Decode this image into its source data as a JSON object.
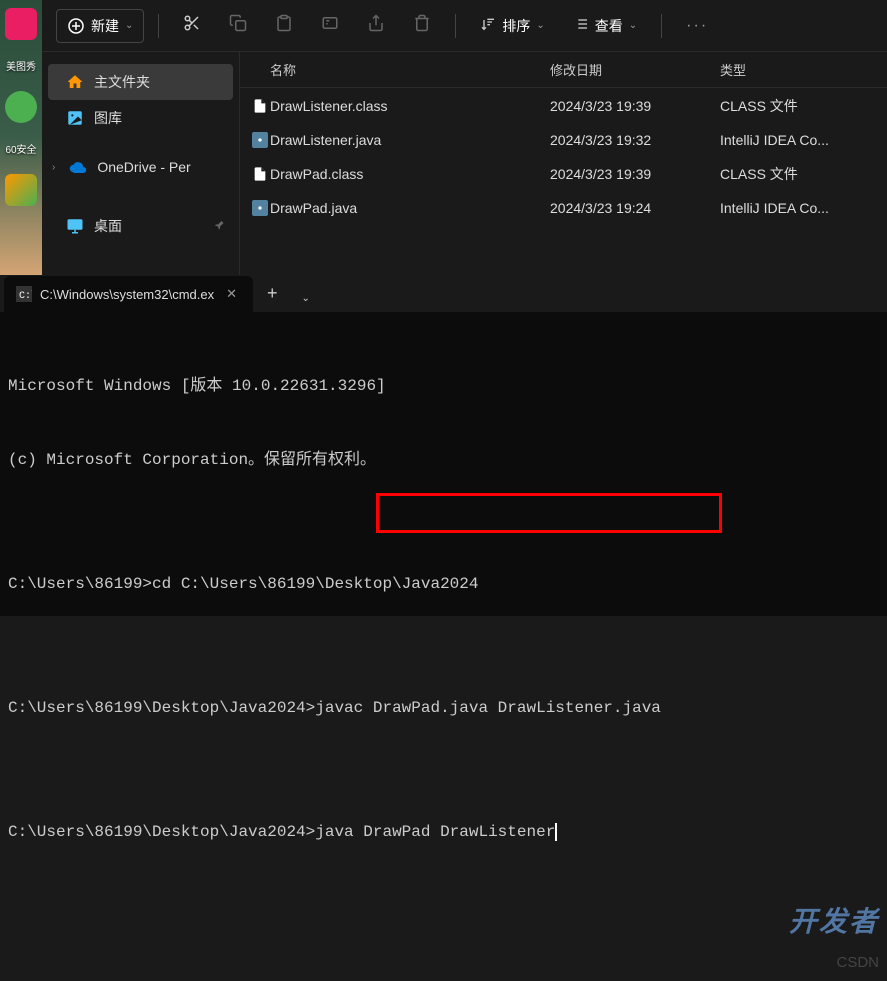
{
  "desktop": {
    "icons": [
      {
        "label": "美图秀",
        "color": "#e91e63"
      },
      {
        "label": "",
        "color": "#4caf50"
      },
      {
        "label": "60安全",
        "color": ""
      },
      {
        "label": "",
        "color": ""
      }
    ]
  },
  "explorer": {
    "toolbar": {
      "new_label": "新建",
      "sort_label": "排序",
      "view_label": "查看"
    },
    "sidebar": {
      "items": [
        {
          "label": "主文件夹",
          "icon": "home",
          "active": true
        },
        {
          "label": "图库",
          "icon": "gallery"
        },
        {
          "label": "OneDrive - Per",
          "icon": "onedrive",
          "expandable": true
        },
        {
          "label": "桌面",
          "icon": "desktop",
          "pinned": true
        }
      ]
    },
    "columns": {
      "name": "名称",
      "date": "修改日期",
      "type": "类型"
    },
    "files": [
      {
        "name": "DrawListener.class",
        "date": "2024/3/23 19:39",
        "type": "CLASS 文件",
        "icon": "class"
      },
      {
        "name": "DrawListener.java",
        "date": "2024/3/23 19:32",
        "type": "IntelliJ IDEA Co...",
        "icon": "java"
      },
      {
        "name": "DrawPad.class",
        "date": "2024/3/23 19:39",
        "type": "CLASS 文件",
        "icon": "class"
      },
      {
        "name": "DrawPad.java",
        "date": "2024/3/23 19:24",
        "type": "IntelliJ IDEA Co...",
        "icon": "java"
      }
    ]
  },
  "terminal": {
    "tab_title": "C:\\Windows\\system32\\cmd.ex",
    "lines": [
      "Microsoft Windows [版本 10.0.22631.3296]",
      "(c) Microsoft Corporation。保留所有权利。",
      "",
      "C:\\Users\\86199>cd C:\\Users\\86199\\Desktop\\Java2024",
      "",
      "C:\\Users\\86199\\Desktop\\Java2024>javac DrawPad.java DrawListener.java",
      "",
      "C:\\Users\\86199\\Desktop\\Java2024>java DrawPad DrawListener"
    ],
    "watermark": "CSDN",
    "watermark2": "开发者"
  }
}
